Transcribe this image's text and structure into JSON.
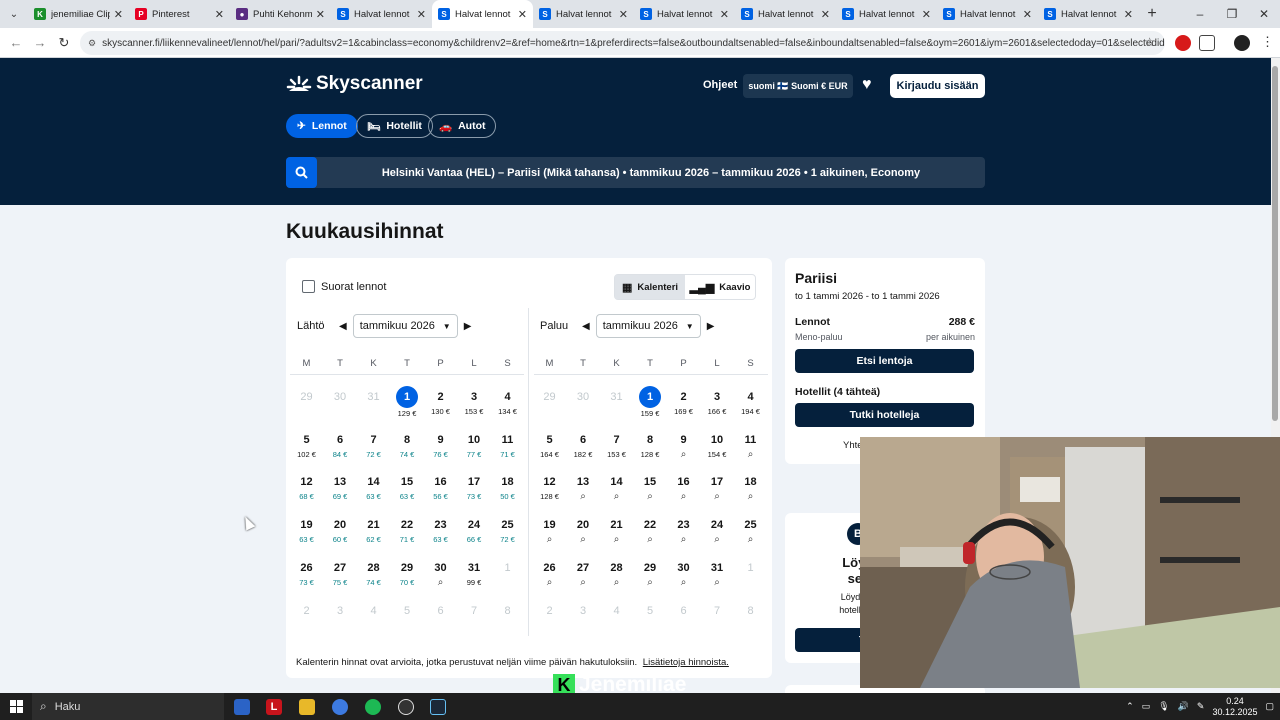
{
  "browser": {
    "tabs": [
      {
        "label": "jenemiliae Clip",
        "fav_color": "#1b8f2c",
        "fav_glyph": "K"
      },
      {
        "label": "Pinterest",
        "fav_color": "#e60023",
        "fav_glyph": "P"
      },
      {
        "label": "Puhti Kehonm",
        "fav_color": "#5a2d82",
        "fav_glyph": "●"
      },
      {
        "label": "Halvat lennot",
        "fav_color": "#0062e3",
        "fav_glyph": "S"
      },
      {
        "label": "Halvat lennot",
        "fav_color": "#0062e3",
        "fav_glyph": "S",
        "active": true
      },
      {
        "label": "Halvat lennot",
        "fav_color": "#0062e3",
        "fav_glyph": "S"
      },
      {
        "label": "Halvat lennot",
        "fav_color": "#0062e3",
        "fav_glyph": "S"
      },
      {
        "label": "Halvat lennot",
        "fav_color": "#0062e3",
        "fav_glyph": "S"
      },
      {
        "label": "Halvat lennot",
        "fav_color": "#0062e3",
        "fav_glyph": "S"
      },
      {
        "label": "Halvat lennot",
        "fav_color": "#0062e3",
        "fav_glyph": "S"
      },
      {
        "label": "Halvat lennot",
        "fav_color": "#0062e3",
        "fav_glyph": "S"
      }
    ],
    "url": "skyscanner.fi/liikennevalineet/lennot/hel/pari/?adultsv2=1&cabinclass=economy&childrenv2=&ref=home&rtn=1&preferdirects=false&outboundaltsenabled=false&inboundaltsenabled=false&oym=2601&iym=2601&selectedoday=01&selectedida..."
  },
  "header": {
    "brand": "Skyscanner",
    "help": "Ohjeet",
    "locale": "suomi 🇫🇮 Suomi € EUR",
    "login": "Kirjaudu sisään",
    "product_tabs": [
      "Lennot",
      "Hotellit",
      "Autot"
    ],
    "search_summary": "Helsinki Vantaa (HEL) – Pariisi (Mikä tahansa)  •  tammikuu 2026 – tammikuu 2026  •  1 aikuinen, Economy"
  },
  "page": {
    "title": "Kuukausihinnat",
    "direct_only": "Suorat lennot",
    "view_calendar": "Kalenteri",
    "view_chart": "Kaavio",
    "depart_label": "Lähtö",
    "depart_month": "tammikuu 2026",
    "return_label": "Paluu",
    "return_month": "tammikuu 2026",
    "weekdays": [
      "M",
      "T",
      "K",
      "T",
      "P",
      "L",
      "S"
    ],
    "footnote": "Kalenterin hinnat ovat arvioita, jotka perustuvat neljän viime päivän hakutuloksiin.",
    "footnote_link": "Lisätietoja hinnoista."
  },
  "depart_calendar": [
    [
      {
        "d": "29",
        "m": 1
      },
      {
        "d": "30",
        "m": 1
      },
      {
        "d": "31",
        "m": 1
      },
      {
        "d": "1",
        "p": "129 €",
        "sel": 1
      },
      {
        "d": "2",
        "p": "130 €"
      },
      {
        "d": "3",
        "p": "153 €"
      },
      {
        "d": "4",
        "p": "134 €"
      }
    ],
    [
      {
        "d": "5",
        "p": "102 €"
      },
      {
        "d": "6",
        "p": "84 €",
        "c": 1
      },
      {
        "d": "7",
        "p": "72 €",
        "c": 1
      },
      {
        "d": "8",
        "p": "74 €",
        "c": 1
      },
      {
        "d": "9",
        "p": "76 €",
        "c": 1
      },
      {
        "d": "10",
        "p": "77 €",
        "c": 1
      },
      {
        "d": "11",
        "p": "71 €",
        "c": 1
      }
    ],
    [
      {
        "d": "12",
        "p": "68 €",
        "c": 1
      },
      {
        "d": "13",
        "p": "69 €",
        "c": 1
      },
      {
        "d": "14",
        "p": "63 €",
        "c": 1
      },
      {
        "d": "15",
        "p": "63 €",
        "c": 1
      },
      {
        "d": "16",
        "p": "56 €",
        "c": 1
      },
      {
        "d": "17",
        "p": "73 €",
        "c": 1
      },
      {
        "d": "18",
        "p": "50 €",
        "c": 1
      }
    ],
    [
      {
        "d": "19",
        "p": "63 €",
        "c": 1
      },
      {
        "d": "20",
        "p": "60 €",
        "c": 1
      },
      {
        "d": "21",
        "p": "62 €",
        "c": 1
      },
      {
        "d": "22",
        "p": "71 €",
        "c": 1
      },
      {
        "d": "23",
        "p": "63 €",
        "c": 1
      },
      {
        "d": "24",
        "p": "66 €",
        "c": 1
      },
      {
        "d": "25",
        "p": "72 €",
        "c": 1
      }
    ],
    [
      {
        "d": "26",
        "p": "73 €",
        "c": 1
      },
      {
        "d": "27",
        "p": "75 €",
        "c": 1
      },
      {
        "d": "28",
        "p": "74 €",
        "c": 1
      },
      {
        "d": "29",
        "p": "70 €",
        "c": 1
      },
      {
        "d": "30",
        "s": 1
      },
      {
        "d": "31",
        "p": "99 €"
      },
      {
        "d": "1",
        "m": 1
      }
    ],
    [
      {
        "d": "2",
        "m": 1
      },
      {
        "d": "3",
        "m": 1
      },
      {
        "d": "4",
        "m": 1
      },
      {
        "d": "5",
        "m": 1
      },
      {
        "d": "6",
        "m": 1
      },
      {
        "d": "7",
        "m": 1
      },
      {
        "d": "8",
        "m": 1
      }
    ]
  ],
  "return_calendar": [
    [
      {
        "d": "29",
        "m": 1
      },
      {
        "d": "30",
        "m": 1
      },
      {
        "d": "31",
        "m": 1
      },
      {
        "d": "1",
        "p": "159 €",
        "sel": 1
      },
      {
        "d": "2",
        "p": "169 €"
      },
      {
        "d": "3",
        "p": "166 €"
      },
      {
        "d": "4",
        "p": "194 €"
      }
    ],
    [
      {
        "d": "5",
        "p": "164 €"
      },
      {
        "d": "6",
        "p": "182 €"
      },
      {
        "d": "7",
        "p": "153 €"
      },
      {
        "d": "8",
        "p": "128 €"
      },
      {
        "d": "9",
        "s": 1
      },
      {
        "d": "10",
        "p": "154 €"
      },
      {
        "d": "11",
        "s": 1
      }
    ],
    [
      {
        "d": "12",
        "p": "128 €"
      },
      {
        "d": "13",
        "s": 1
      },
      {
        "d": "14",
        "s": 1
      },
      {
        "d": "15",
        "s": 1
      },
      {
        "d": "16",
        "s": 1
      },
      {
        "d": "17",
        "s": 1
      },
      {
        "d": "18",
        "s": 1
      }
    ],
    [
      {
        "d": "19",
        "s": 1
      },
      {
        "d": "20",
        "s": 1
      },
      {
        "d": "21",
        "s": 1
      },
      {
        "d": "22",
        "s": 1
      },
      {
        "d": "23",
        "s": 1
      },
      {
        "d": "24",
        "s": 1
      },
      {
        "d": "25",
        "s": 1
      }
    ],
    [
      {
        "d": "26",
        "s": 1
      },
      {
        "d": "27",
        "s": 1
      },
      {
        "d": "28",
        "s": 1
      },
      {
        "d": "29",
        "s": 1
      },
      {
        "d": "30",
        "s": 1
      },
      {
        "d": "31",
        "s": 1
      },
      {
        "d": "1",
        "m": 1
      }
    ],
    [
      {
        "d": "2",
        "m": 1
      },
      {
        "d": "3",
        "m": 1
      },
      {
        "d": "4",
        "m": 1
      },
      {
        "d": "5",
        "m": 1
      },
      {
        "d": "6",
        "m": 1
      },
      {
        "d": "7",
        "m": 1
      },
      {
        "d": "8",
        "m": 1
      }
    ]
  ],
  "side": {
    "destination": "Pariisi",
    "range": "to 1 tammi 2026 - to 1 tammi 2026",
    "flights_label": "Lennot",
    "flights_price": "288 €",
    "trip_type": "Meno-paluu",
    "per_person": "per aikuinen",
    "find_flights": "Etsi lentoja",
    "hotels_label": "Hotellit (4 tähteä)",
    "browse_hotels": "Tutki hotelleja",
    "total_partial": "Yhte"
  },
  "promo": {
    "badge": "B",
    "title": "Löysitk\nseura",
    "desc": "Löydät tulok\nhotellisivusto",
    "button": "Tu"
  },
  "overlay": {
    "watermark": "Jenemiliae",
    "watermark_badge": "K"
  },
  "taskbar": {
    "search": "Haku",
    "time": "0.24",
    "date": "30.12.2025"
  },
  "colors": {
    "accent": "#0062e3",
    "navy": "#05203c",
    "cheap": "#0c838a"
  }
}
